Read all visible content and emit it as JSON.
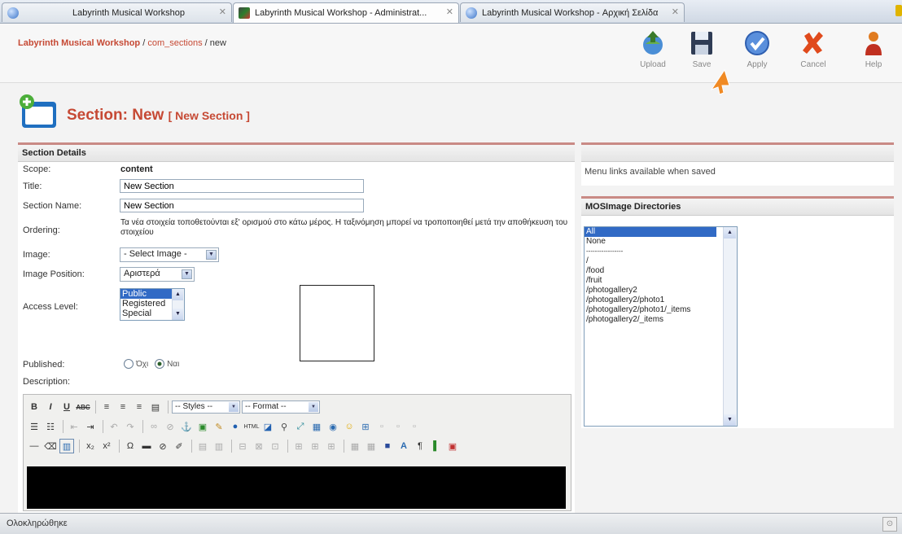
{
  "browser": {
    "tabs": [
      {
        "label": "Labyrinth Musical Workshop",
        "active": false
      },
      {
        "label": "Labyrinth Musical Workshop - Administrat...",
        "active": true
      },
      {
        "label": "Labyrinth Musical Workshop - Αρχική Σελίδα",
        "active": false
      }
    ]
  },
  "header": {
    "breadcrumb_site": "Labyrinth Musical Workshop",
    "breadcrumb_rest_1": " / ",
    "breadcrumb_component": "com_sections",
    "breadcrumb_rest_2": " / new",
    "toolbar": {
      "upload": "Upload",
      "save": "Save",
      "apply": "Apply",
      "cancel": "Cancel",
      "help": "Help"
    }
  },
  "page": {
    "title": "Section: New",
    "subtitle": "[ New Section ]"
  },
  "details": {
    "heading": "Section Details",
    "scope_label": "Scope:",
    "scope_value": "content",
    "title_label": "Title:",
    "title_value": "New Section",
    "name_label": "Section Name:",
    "name_value": "New Section",
    "ordering_label": "Ordering:",
    "ordering_text": "Τα νέα στοιχεία τοποθετούνται εξ' ορισμού στο κάτω μέρος. Η ταξινόμηση μπορεί να τροποποιηθεί μετά την αποθήκευση του στοιχείου",
    "image_label": "Image:",
    "image_value": "- Select Image -",
    "image_position_label": "Image Position:",
    "image_position_value": "Αριστερά",
    "access_label": "Access Level:",
    "access_options": [
      "Public",
      "Registered",
      "Special"
    ],
    "access_selected": "Public",
    "published_label": "Published:",
    "published_no": "Όχι",
    "published_yes": "Ναι",
    "published_value": "Ναι",
    "description_label": "Description:"
  },
  "editor": {
    "styles_select": "-- Styles --",
    "format_select": "-- Format --"
  },
  "right": {
    "menu_links_text": "Menu links available when saved",
    "mosimage_heading": "MOSImage Directories",
    "directories": [
      "All",
      "None",
      "-----------------",
      "/",
      "/food",
      "/fruit",
      "/photogallery2",
      "/photogallery2/photo1",
      "/photogallery2/photo1/_items",
      "/photogallery2/_items"
    ],
    "directories_selected": "All"
  },
  "status": {
    "text": "Ολοκληρώθηκε"
  },
  "colors": {
    "accent": "#c64934",
    "panel_border": "#c98a85",
    "selection": "#316ac5"
  }
}
